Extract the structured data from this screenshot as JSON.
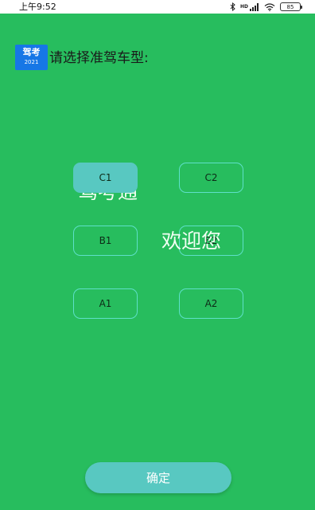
{
  "status_bar": {
    "time": "上午9:52",
    "network_label": "HD",
    "battery": "85"
  },
  "header": {
    "logo_title": "驾考",
    "logo_year": "2021",
    "prompt": "请选择准驾车型:"
  },
  "watermark": {
    "app_name": "驾考通",
    "welcome": "欢迎您"
  },
  "license_options": [
    {
      "label": "C1",
      "selected": true
    },
    {
      "label": "C2",
      "selected": false
    },
    {
      "label": "B1",
      "selected": false
    },
    {
      "label": "B2",
      "selected": false
    },
    {
      "label": "A1",
      "selected": false
    },
    {
      "label": "A2",
      "selected": false
    }
  ],
  "confirm_button": {
    "label": "确定"
  },
  "colors": {
    "background": "#27bd5e",
    "accent": "#58c8c1",
    "logo_blue": "#1677e6",
    "button_border": "#5ee0c9"
  },
  "icons": {
    "status": [
      "bluetooth-icon",
      "signal-icon",
      "wifi-icon",
      "battery-icon"
    ]
  }
}
